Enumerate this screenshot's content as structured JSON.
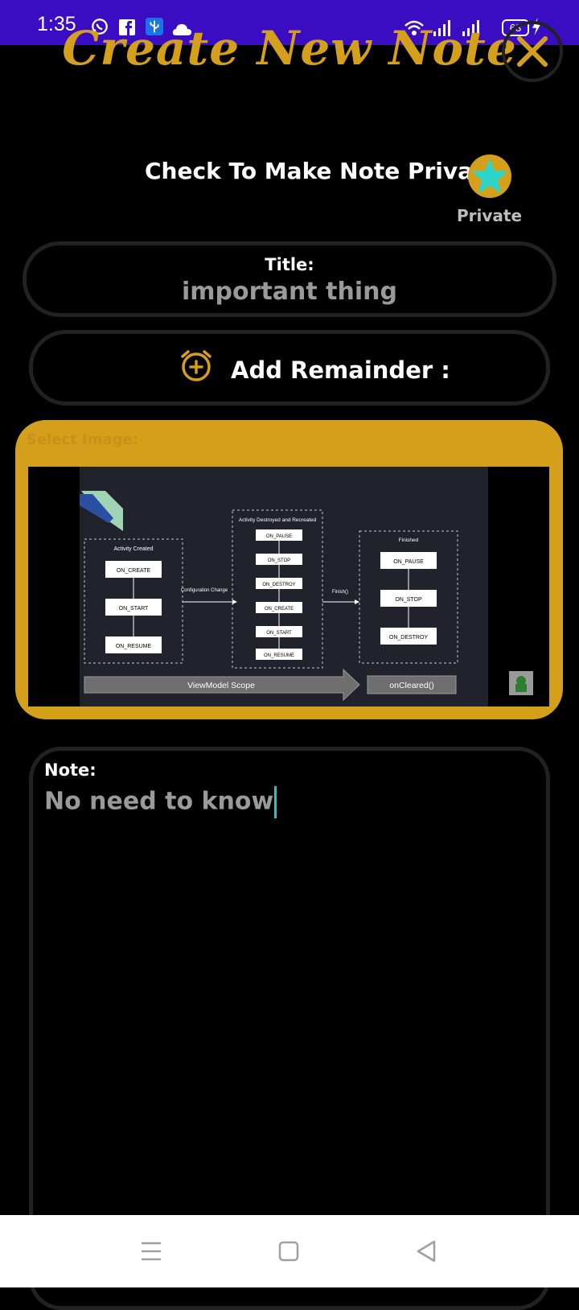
{
  "status_bar": {
    "time": "1:35",
    "battery": "63",
    "icons": [
      "whatsapp-icon",
      "facebook-icon",
      "usb-icon",
      "cloud-icon",
      "wifi-icon",
      "signal-icon",
      "signal-icon",
      "charging-icon"
    ]
  },
  "header": {
    "title": "Create New Note",
    "close_icon": "close-icon"
  },
  "privacy": {
    "label": "Check To Make Note Private:",
    "toggle_text": "Private",
    "icon": "star-icon"
  },
  "title_field": {
    "caption": "Title:",
    "value": "important thing"
  },
  "reminder": {
    "label": "Add Remainder :",
    "icon": "alarm-add-icon"
  },
  "image_section": {
    "caption": "Select Image:",
    "diagram": {
      "created_title": "Activity Created",
      "destroyed_title": "Activity Destroyed and Recreated",
      "finished_title": "Finished",
      "config_change": "Configuration Change",
      "finish_label": "Finish()",
      "created_states": [
        "ON_CREATE",
        "ON_START",
        "ON_RESUME"
      ],
      "destroyed_states": [
        "ON_PAUSE",
        "ON_STOP",
        "ON_DESTROY",
        "ON_CREATE",
        "ON_START",
        "ON_RESUME"
      ],
      "finished_states": [
        "ON_PAUSE",
        "ON_STOP",
        "ON_DESTROY"
      ],
      "scope_label": "ViewModel Scope",
      "cleared_label": "onCleared()"
    }
  },
  "note_field": {
    "caption": "Note:",
    "value": "No need to know"
  },
  "nav_bar": {
    "items": [
      "menu-icon",
      "home-icon",
      "back-icon"
    ]
  },
  "colors": {
    "accent": "#d4a01c",
    "status_bar": "#3a0cc2",
    "star": "#2fd6c8",
    "background": "#000000"
  }
}
